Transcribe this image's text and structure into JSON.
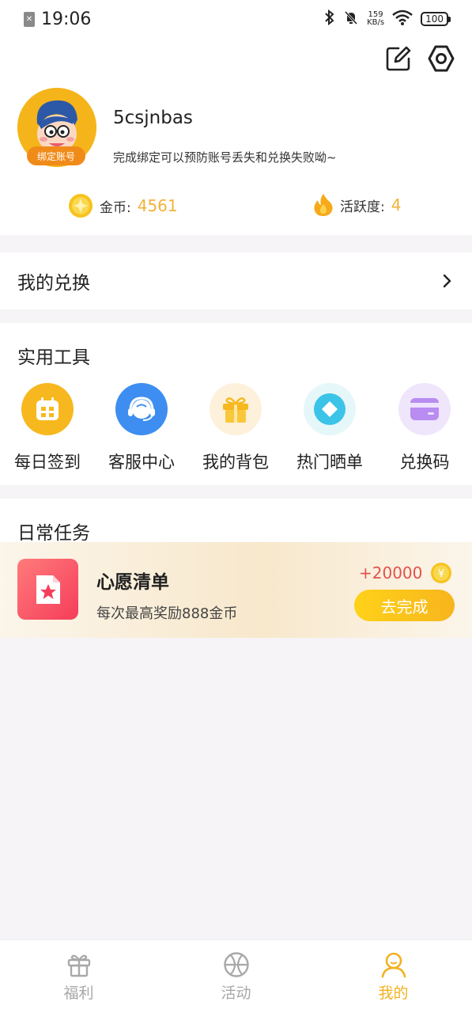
{
  "status_bar": {
    "time": "19:06",
    "speed_value": "159",
    "speed_unit": "KB/s",
    "battery": "100"
  },
  "profile": {
    "username": "5csjnbas",
    "bind_badge": "绑定账号",
    "bind_tip": "完成绑定可以预防账号丢失和兑换失败呦~",
    "coins_label": "金币:",
    "coins_value": "4561",
    "activity_label": "活跃度:",
    "activity_value": "4"
  },
  "exchange": {
    "label": "我的兑换"
  },
  "tools": {
    "title": "实用工具",
    "items": [
      {
        "label": "每日签到",
        "icon": "calendar-icon",
        "color": "#f7b81f"
      },
      {
        "label": "客服中心",
        "icon": "headset-icon",
        "color": "#3d8ef0"
      },
      {
        "label": "我的背包",
        "icon": "gift-icon",
        "color": "#fdf1dc"
      },
      {
        "label": "热门晒单",
        "icon": "diamond-icon",
        "color": "#e6f7fa"
      },
      {
        "label": "兑换码",
        "icon": "card-icon",
        "color": "#efe6fb"
      }
    ]
  },
  "tasks": {
    "title": "日常任务",
    "items": [
      {
        "name": "心愿清单",
        "desc": "每次最高奖励888金币",
        "reward": "+20000",
        "button": "去完成"
      }
    ]
  },
  "bottom_nav": {
    "items": [
      {
        "label": "福利",
        "icon": "gift-icon",
        "active": false
      },
      {
        "label": "活动",
        "icon": "basketball-icon",
        "active": false
      },
      {
        "label": "我的",
        "icon": "user-icon",
        "active": true
      }
    ]
  },
  "colors": {
    "accent": "#f3b11f",
    "reward_red": "#e3524a",
    "background": "#f6f4f7"
  }
}
